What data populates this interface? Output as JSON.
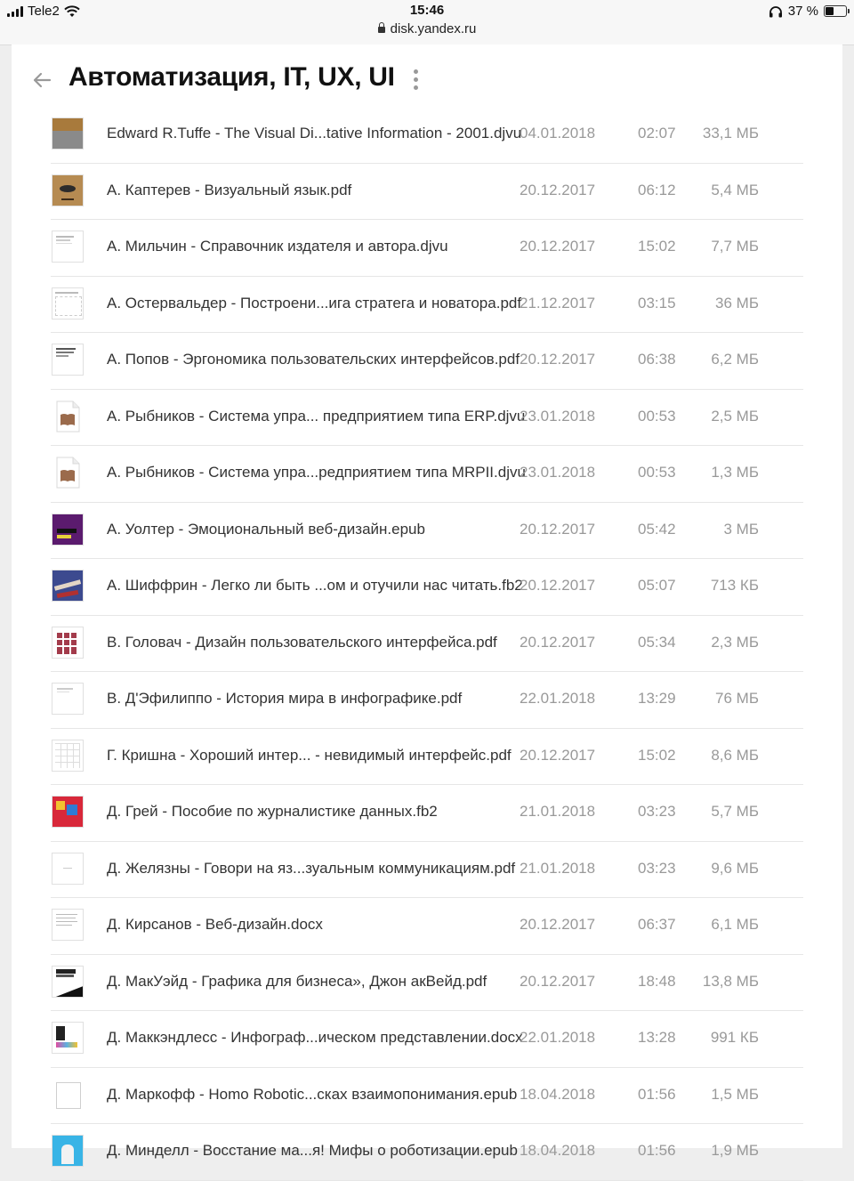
{
  "status": {
    "carrier": "Tele2",
    "time": "15:46",
    "url": "disk.yandex.ru",
    "battery": "37 %",
    "battery_level": 0.37
  },
  "header": {
    "title": "Автоматизация, IT, UX, UI"
  },
  "files": [
    {
      "name": "Edward R.Tuffe - The Visual Di...tative Information - 2001.djvu",
      "date": "04.01.2018",
      "time": "02:07",
      "size": "33,1 МБ",
      "thumb": "book-cover-icon"
    },
    {
      "name": "А. Каптерев - Визуальный язык.pdf",
      "date": "20.12.2017",
      "time": "06:12",
      "size": "5,4 МБ",
      "thumb": "book-cover-icon"
    },
    {
      "name": "А. Мильчин - Справочник издателя и автора.djvu",
      "date": "20.12.2017",
      "time": "15:02",
      "size": "7,7 МБ",
      "thumb": "document-page-icon"
    },
    {
      "name": "А. Остервальдер - Построени...ига стратега и новатора.pdf",
      "date": "21.12.2017",
      "time": "03:15",
      "size": "36 МБ",
      "thumb": "document-page-icon"
    },
    {
      "name": "А. Попов - Эргономика пользовательских интерфейсов.pdf",
      "date": "20.12.2017",
      "time": "06:38",
      "size": "6,2 МБ",
      "thumb": "document-page-icon"
    },
    {
      "name": "А. Рыбников - Система упра... предприятием типа ERP.djvu",
      "date": "23.01.2018",
      "time": "00:53",
      "size": "2,5 МБ",
      "thumb": "book-file-icon"
    },
    {
      "name": "А. Рыбников - Система упра...редприятием типа MRPII.djvu",
      "date": "23.01.2018",
      "time": "00:53",
      "size": "1,3 МБ",
      "thumb": "book-file-icon"
    },
    {
      "name": "А. Уолтер - Эмоциональный веб-дизайн.epub",
      "date": "20.12.2017",
      "time": "05:42",
      "size": "3 МБ",
      "thumb": "book-cover-icon"
    },
    {
      "name": "А. Шиффрин - Легко ли быть ...ом и отучили нас читать.fb2",
      "date": "20.12.2017",
      "time": "05:07",
      "size": "713 КБ",
      "thumb": "book-cover-icon"
    },
    {
      "name": "В. Головач - Дизайн пользовательского интерфейса.pdf",
      "date": "20.12.2017",
      "time": "05:34",
      "size": "2,3 МБ",
      "thumb": "book-cover-icon"
    },
    {
      "name": "В. Д'Эфилиппо - История мира в инфографике.pdf",
      "date": "22.01.2018",
      "time": "13:29",
      "size": "76 МБ",
      "thumb": "document-page-icon"
    },
    {
      "name": "Г. Кришна - Хороший интер... - невидимый интерфейс.pdf",
      "date": "20.12.2017",
      "time": "15:02",
      "size": "8,6 МБ",
      "thumb": "document-page-icon"
    },
    {
      "name": "Д. Грей - Пособие по журналистике данных.fb2",
      "date": "21.01.2018",
      "time": "03:23",
      "size": "5,7 МБ",
      "thumb": "book-cover-icon"
    },
    {
      "name": "Д. Желязны - Говори на яз...зуальным коммуникациям.pdf",
      "date": "21.01.2018",
      "time": "03:23",
      "size": "9,6 МБ",
      "thumb": "document-page-icon"
    },
    {
      "name": "Д. Кирсанов - Веб-дизайн.docx",
      "date": "20.12.2017",
      "time": "06:37",
      "size": "6,1 МБ",
      "thumb": "document-page-icon"
    },
    {
      "name": "Д. МакУэйд - Графика для бизнеса», Джон акВейд.pdf",
      "date": "20.12.2017",
      "time": "18:48",
      "size": "13,8 МБ",
      "thumb": "book-cover-icon"
    },
    {
      "name": "Д. Маккэндлесс - Инфограф...ическом представлении.docx",
      "date": "22.01.2018",
      "time": "13:28",
      "size": "991 КБ",
      "thumb": "document-page-icon"
    },
    {
      "name": "Д. Маркофф - Homo Robotic...сках взаимопонимания.epub",
      "date": "18.04.2018",
      "time": "01:56",
      "size": "1,5 МБ",
      "thumb": "blank-file-icon"
    },
    {
      "name": "Д. Минделл - Восстание ма...я! Мифы о роботизации.epub",
      "date": "18.04.2018",
      "time": "01:56",
      "size": "1,9 МБ",
      "thumb": "book-cover-icon"
    }
  ]
}
